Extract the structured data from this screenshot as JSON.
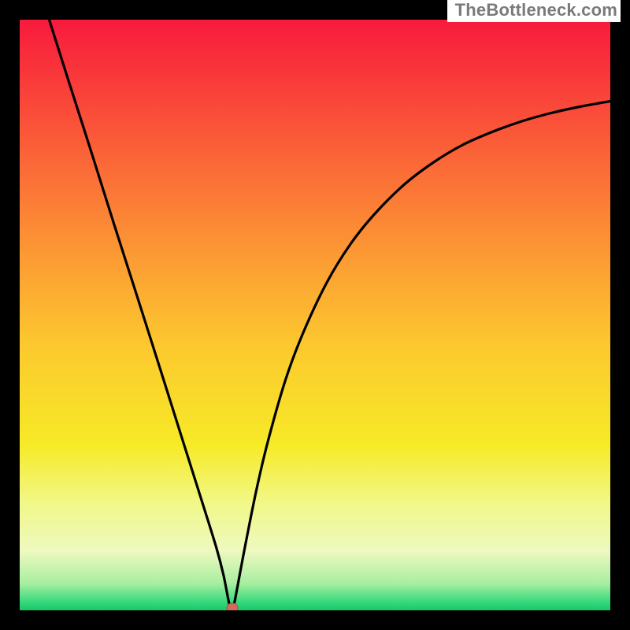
{
  "watermark": "TheBottleneck.com",
  "chart_data": {
    "type": "line",
    "title": "",
    "xlabel": "",
    "ylabel": "",
    "xlim": [
      0,
      100
    ],
    "ylim": [
      0,
      100
    ],
    "grid": false,
    "legend": "none",
    "gradient_stops": [
      {
        "offset": 0.0,
        "color": "#f71a3c"
      },
      {
        "offset": 0.12,
        "color": "#f9403a"
      },
      {
        "offset": 0.25,
        "color": "#fb6a37"
      },
      {
        "offset": 0.4,
        "color": "#fc9a34"
      },
      {
        "offset": 0.55,
        "color": "#fcc82e"
      },
      {
        "offset": 0.72,
        "color": "#f7ea27"
      },
      {
        "offset": 0.82,
        "color": "#f1f889"
      },
      {
        "offset": 0.9,
        "color": "#edf9c0"
      },
      {
        "offset": 0.955,
        "color": "#a7eea0"
      },
      {
        "offset": 0.985,
        "color": "#3ad97f"
      },
      {
        "offset": 1.0,
        "color": "#18c867"
      }
    ],
    "series": [
      {
        "name": "curve",
        "x": [
          5.0,
          8.0,
          12.0,
          16.0,
          20.0,
          24.0,
          28.0,
          31.0,
          33.3,
          34.5,
          35.5,
          36.0,
          36.5,
          38.0,
          40.0,
          42.0,
          45.0,
          48.0,
          52.0,
          56.0,
          60.0,
          65.0,
          70.0,
          75.0,
          80.0,
          85.0,
          90.0,
          95.0,
          100.0
        ],
        "y": [
          100.0,
          90.5,
          78.0,
          65.3,
          52.8,
          40.2,
          27.5,
          18.0,
          10.6,
          6.0,
          1.0,
          0.0,
          2.0,
          10.0,
          20.0,
          28.5,
          39.0,
          47.0,
          55.5,
          62.0,
          67.0,
          72.0,
          75.8,
          78.8,
          81.0,
          82.8,
          84.2,
          85.3,
          86.2
        ]
      }
    ],
    "marker": {
      "x": 36.0,
      "y": 0.0,
      "color": "#d46a5a",
      "radius_px": 7
    }
  }
}
